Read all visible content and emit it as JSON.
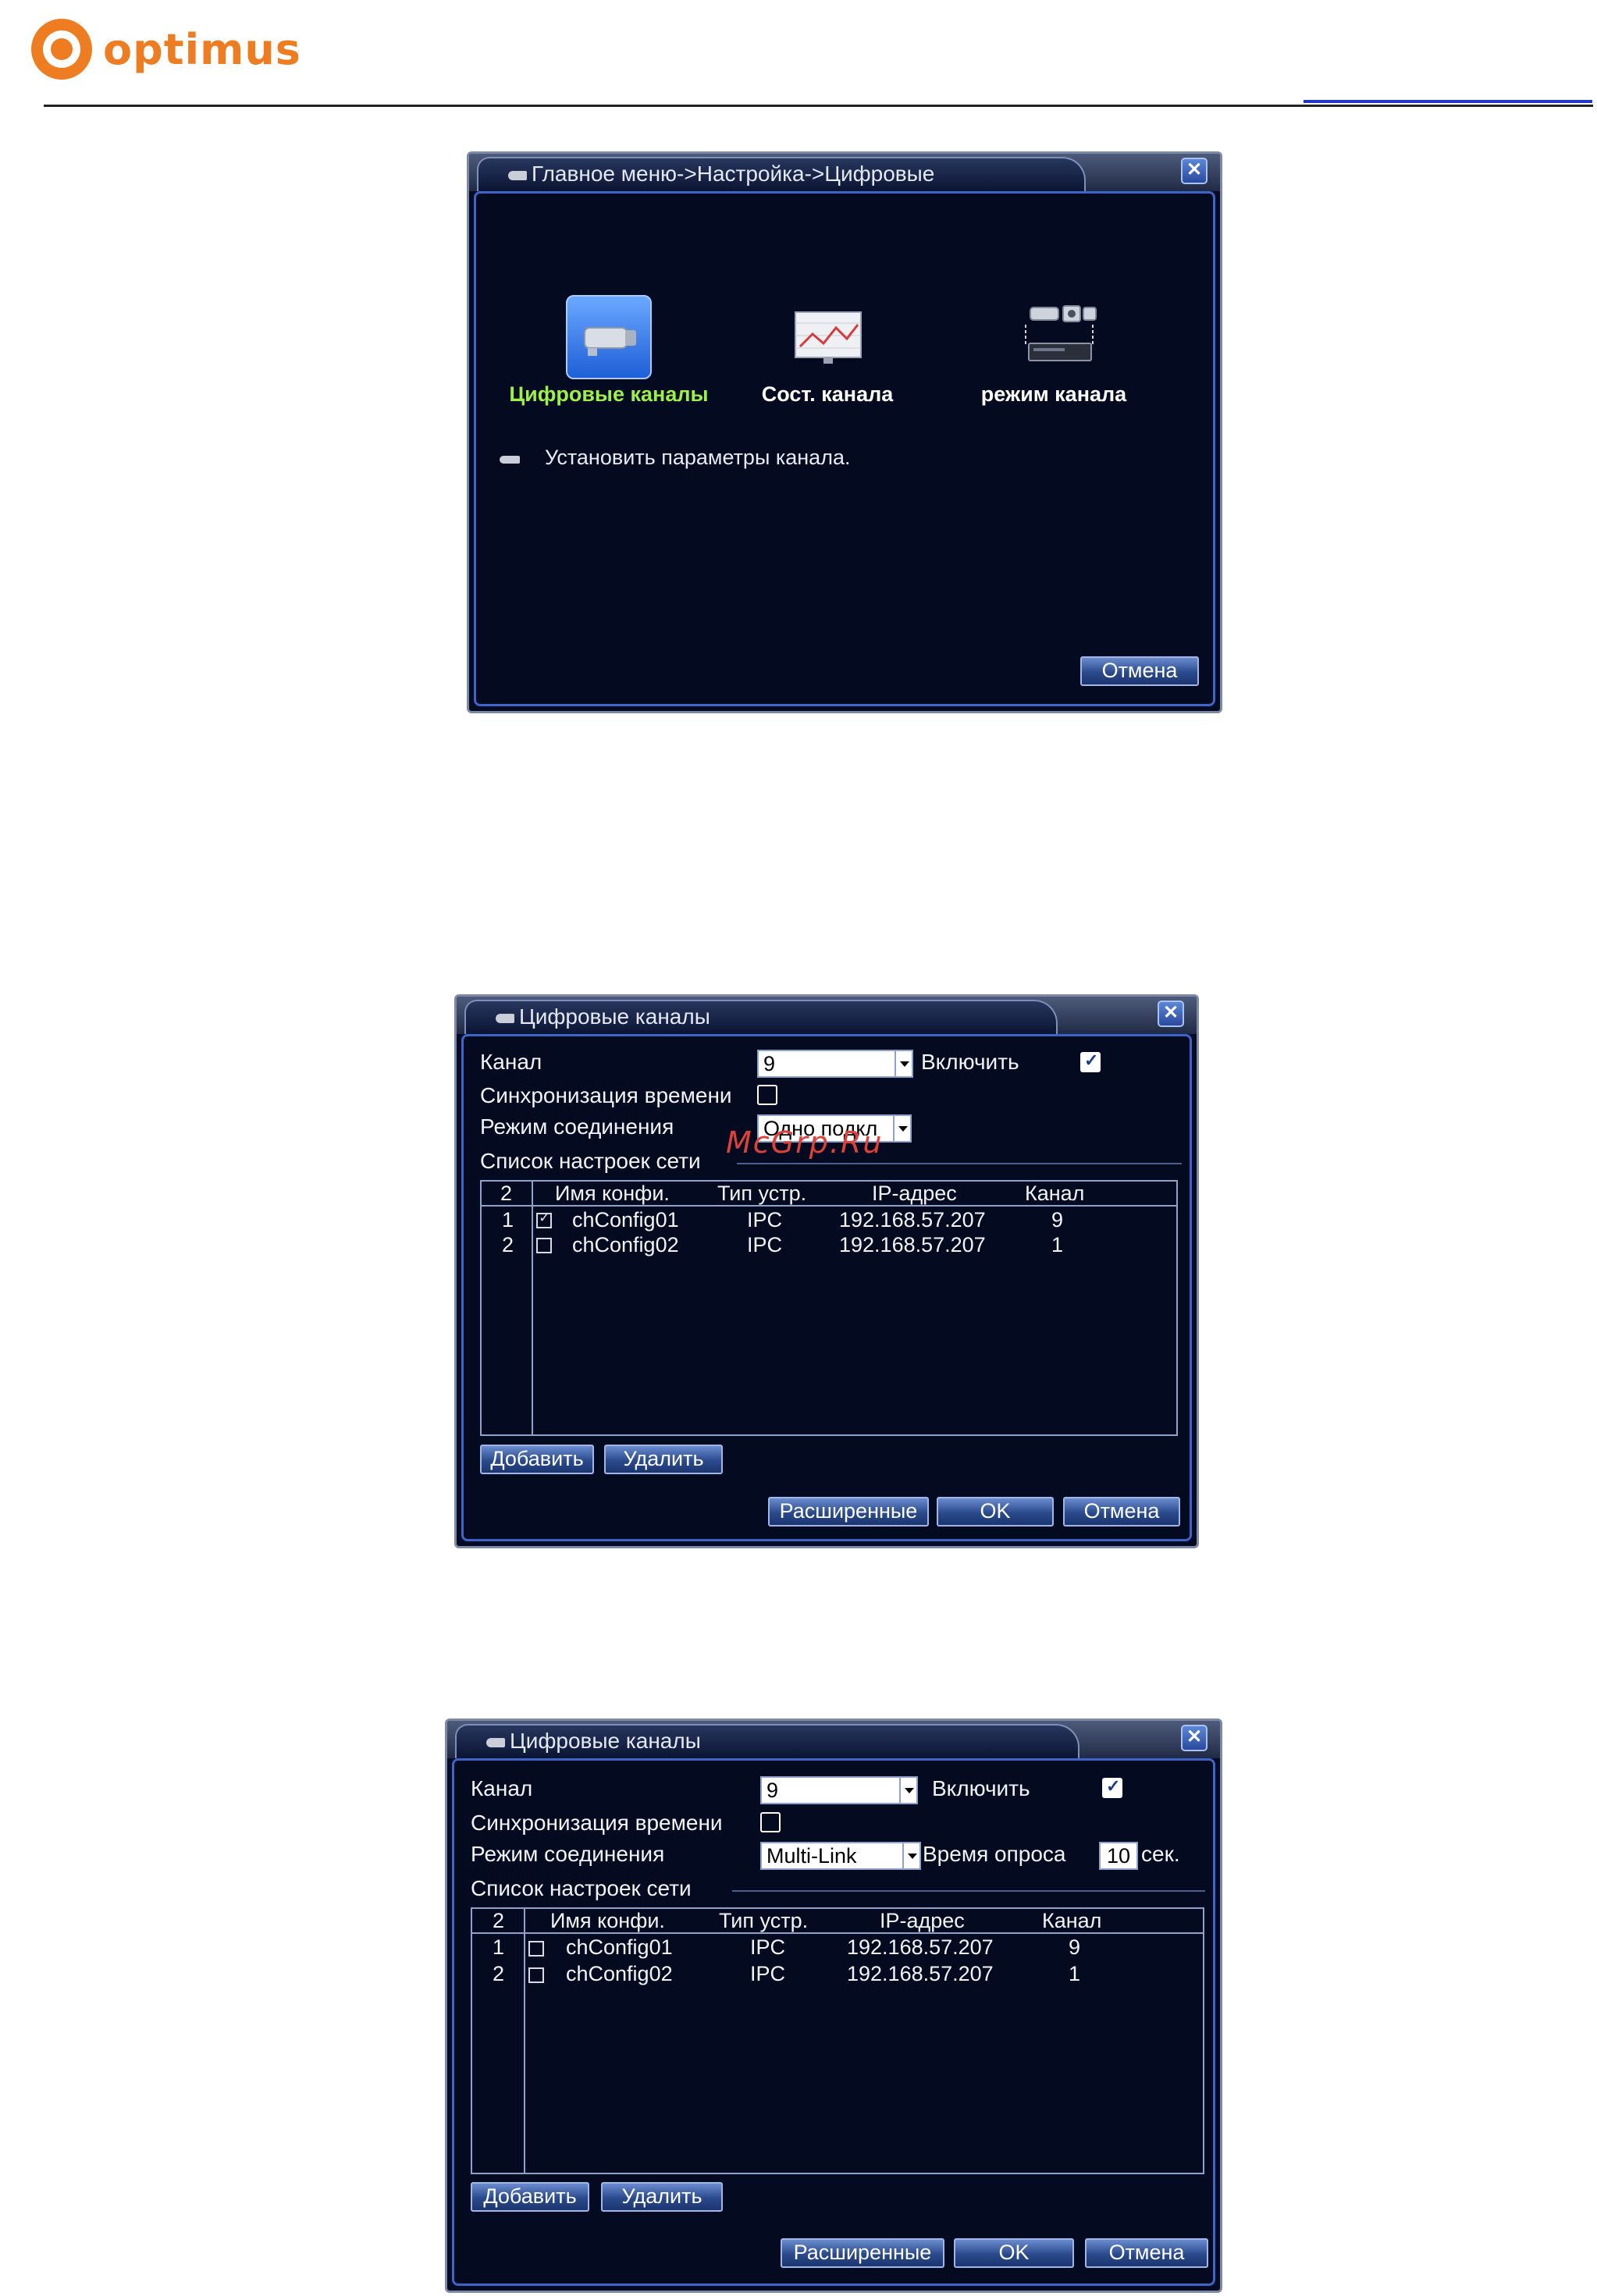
{
  "header": {
    "brand": "optimus"
  },
  "watermark": "McGrp.Ru",
  "window1": {
    "title": "Главное меню->Настройка->Цифровые",
    "items": [
      {
        "label": "Цифровые каналы",
        "icon": "ip-camera-icon",
        "selected": true
      },
      {
        "label": "Сост. канала",
        "icon": "chart-icon",
        "selected": false
      },
      {
        "label": "режим канала",
        "icon": "camera-dvr-icon",
        "selected": false
      }
    ],
    "hint": "Установить параметры канала.",
    "cancel": "Отмена"
  },
  "window2": {
    "title": "Цифровые каналы",
    "channel_label": "Канал",
    "channel_value": "9",
    "enable_label": "Включить",
    "enable_checked": true,
    "timesync_label": "Синхронизация времени",
    "timesync_checked": false,
    "mode_label": "Режим соединения",
    "mode_value": "Одно подкл",
    "list_label": "Список настроек сети",
    "columns": [
      "2",
      "Имя конфи.",
      "Тип устр.",
      "IP-адрес",
      "Канал"
    ],
    "rows": [
      {
        "num": "1",
        "checked": true,
        "name": "chConfig01",
        "type": "IPC",
        "ip": "192.168.57.207",
        "channel": "9"
      },
      {
        "num": "2",
        "checked": false,
        "name": "chConfig02",
        "type": "IPC",
        "ip": "192.168.57.207",
        "channel": "1"
      }
    ],
    "add": "Добавить",
    "delete": "Удалить",
    "advanced": "Расширенные",
    "ok": "OK",
    "cancel": "Отмена"
  },
  "window3": {
    "title": "Цифровые каналы",
    "channel_label": "Канал",
    "channel_value": "9",
    "enable_label": "Включить",
    "enable_checked": true,
    "timesync_label": "Синхронизация времени",
    "timesync_checked": false,
    "mode_label": "Режим соединения",
    "mode_value": "Multi-Link",
    "poll_label": "Время опроса",
    "poll_value": "10",
    "poll_unit": "сек.",
    "list_label": "Список настроек сети",
    "columns": [
      "2",
      "Имя конфи.",
      "Тип устр.",
      "IP-адрес",
      "Канал"
    ],
    "rows": [
      {
        "num": "1",
        "checked": false,
        "name": "chConfig01",
        "type": "IPC",
        "ip": "192.168.57.207",
        "channel": "9"
      },
      {
        "num": "2",
        "checked": false,
        "name": "chConfig02",
        "type": "IPC",
        "ip": "192.168.57.207",
        "channel": "1"
      }
    ],
    "add": "Добавить",
    "delete": "Удалить",
    "advanced": "Расширенные",
    "ok": "OK",
    "cancel": "Отмена"
  },
  "colors": {
    "brand": "#ee7d22",
    "window_bg": "#050b22",
    "selected_label": "#9df04a",
    "frame": "#3f64c8"
  }
}
